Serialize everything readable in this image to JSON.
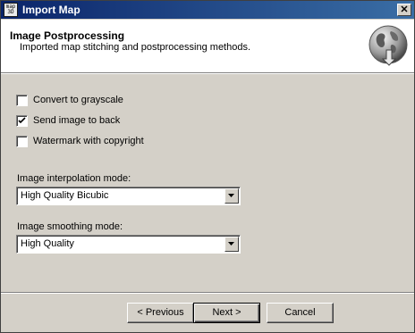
{
  "window": {
    "title": "Import Map",
    "app_icon_text": "map3D",
    "close_glyph": "✕"
  },
  "header": {
    "title": "Image Postprocessing",
    "subtitle": "Imported map stitching and postprocessing methods.",
    "icon": "globe-download-icon"
  },
  "options": [
    {
      "label": "Convert to grayscale",
      "checked": false
    },
    {
      "label": "Send image to back",
      "checked": true
    },
    {
      "label": "Watermark with copyright",
      "checked": false
    }
  ],
  "interpolation": {
    "label": "Image interpolation mode:",
    "value": "High Quality Bicubic"
  },
  "smoothing": {
    "label": "Image smoothing mode:",
    "value": "High Quality"
  },
  "buttons": {
    "previous": "< Previous",
    "next": "Next >",
    "cancel": "Cancel"
  },
  "colors": {
    "titlebar_start": "#0a246a",
    "titlebar_end": "#3a6ea5",
    "dialog_bg": "#d4d0c8"
  }
}
